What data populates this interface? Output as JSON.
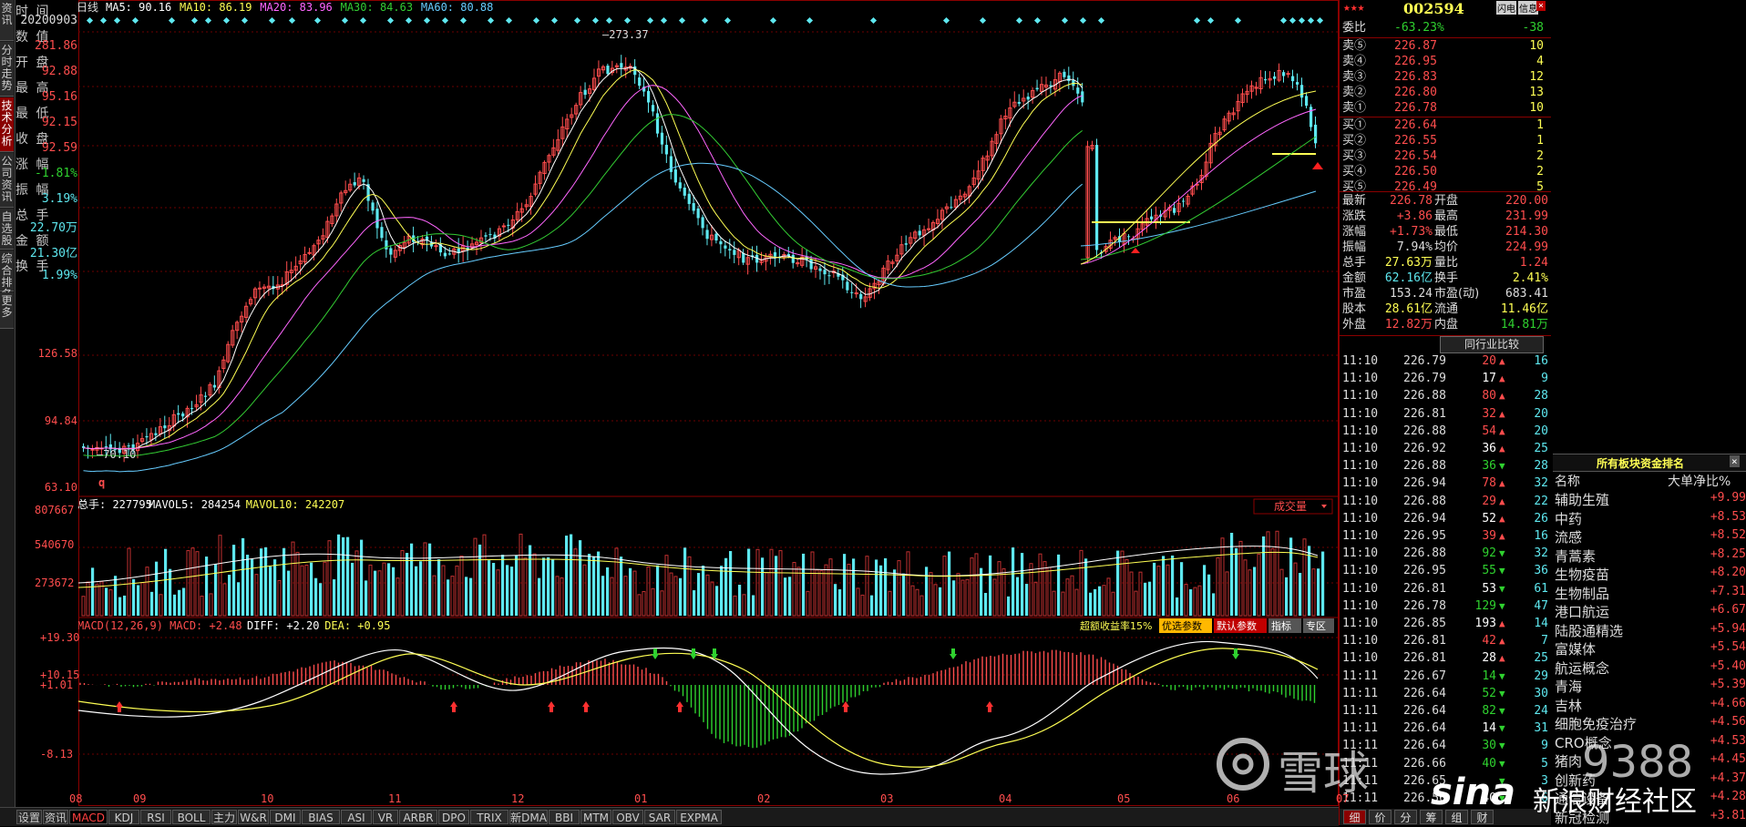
{
  "left_tabs": [
    "资讯",
    "分时走势",
    "技术分析",
    "公司资讯",
    "自选股",
    "综合排名",
    "更多"
  ],
  "left_info": {
    "rows": [
      {
        "label": "时  间",
        "value": "20200903",
        "color": "#dddddd"
      },
      {
        "label": "数  值",
        "value": "281.86",
        "color": "#ff4d4d"
      },
      {
        "label": "开  盘",
        "value": "92.88",
        "color": "#ff4d4d"
      },
      {
        "label": "最  高",
        "value": "95.16",
        "color": "#ff4d4d"
      },
      {
        "label": "最  低",
        "value": "92.15",
        "color": "#ff4d4d"
      },
      {
        "label": "收  盘",
        "value": "92.59",
        "color": "#ff4d4d"
      },
      {
        "label": "涨  幅",
        "value": "-1.81%",
        "color": "#2fd12f"
      },
      {
        "label": "振  幅",
        "value": "3.19%",
        "color": "#5ee8f0"
      },
      {
        "label": "总  手",
        "value": "22.70万",
        "color": "#5ee8f0"
      },
      {
        "label": "金  额",
        "value": "21.30亿",
        "color": "#5ee8f0"
      },
      {
        "label": "换  手",
        "value": "1.99%",
        "color": "#5ee8f0"
      }
    ]
  },
  "main_chart": {
    "period": "日线",
    "ma_legend": [
      {
        "text": "MA5: 90.16",
        "color": "#ffffff"
      },
      {
        "text": "MA10: 86.19",
        "color": "#ffff54"
      },
      {
        "text": "MA20: 83.96",
        "color": "#ff66ff"
      },
      {
        "text": "MA30: 84.63",
        "color": "#33cc33"
      },
      {
        "text": "MA60: 80.88",
        "color": "#66ccff"
      }
    ],
    "price_axis": [
      "126.58",
      "94.84",
      "63.10"
    ],
    "high_label": "273.37",
    "low_label": "70.10",
    "q_label": "q"
  },
  "volume_panel": {
    "legend": [
      {
        "text": "总手: 227795",
        "color": "#ffffff"
      },
      {
        "text": "MAVOL5: 284254",
        "color": "#ffffff"
      },
      {
        "text": "MAVOL10: 242207",
        "color": "#ffff54"
      }
    ],
    "axis": [
      "807667",
      "540670",
      "273672"
    ],
    "selector": "成交量"
  },
  "macd_panel": {
    "legend": [
      {
        "text": "MACD(12,26,9) MACD: +2.48",
        "color": "#ff4d4d"
      },
      {
        "text": "DIFF: +2.20",
        "color": "#ffffff"
      },
      {
        "text": "DEA: +0.95",
        "color": "#ffff54"
      }
    ],
    "axis": [
      "+19.30",
      "+10.15",
      "+1.01",
      "-8.13"
    ],
    "tags": [
      {
        "text": "超额收益率15%",
        "style": "plain"
      },
      {
        "text": "优选参数",
        "style": "yellow"
      },
      {
        "text": "默认参数",
        "style": "red"
      },
      {
        "text": "指标",
        "style": "gray"
      },
      {
        "text": "专区",
        "style": "gray"
      }
    ]
  },
  "months": [
    "08",
    "09",
    "10",
    "11",
    "12",
    "01",
    "02",
    "03",
    "04",
    "05",
    "06",
    "07"
  ],
  "bottom_tabs": [
    "设置",
    "资讯",
    "MACD",
    "KDJ",
    "RSI",
    "BOLL",
    "主力",
    "W&R",
    "DMI",
    "BIAS",
    "ASI",
    "VR",
    "ARBR",
    "DPO",
    "TRIX",
    "新DMA",
    "BBI",
    "MTM",
    "OBV",
    "SAR",
    "EXPMA"
  ],
  "quote": {
    "code": "002594",
    "top_buttons": [
      "闪电",
      "信息"
    ],
    "weibi": {
      "label": "委比",
      "value": "-63.23%",
      "diff": "-38"
    },
    "sells": [
      {
        "label": "卖⑤",
        "price": "226.87",
        "vol": "10"
      },
      {
        "label": "卖④",
        "price": "226.95",
        "vol": "4"
      },
      {
        "label": "卖③",
        "price": "226.83",
        "vol": "12"
      },
      {
        "label": "卖②",
        "price": "226.80",
        "vol": "13"
      },
      {
        "label": "卖①",
        "price": "226.78",
        "vol": "10"
      }
    ],
    "buys": [
      {
        "label": "买①",
        "price": "226.64",
        "vol": "1"
      },
      {
        "label": "买②",
        "price": "226.55",
        "vol": "1"
      },
      {
        "label": "买③",
        "price": "226.54",
        "vol": "2"
      },
      {
        "label": "买④",
        "price": "226.50",
        "vol": "2"
      },
      {
        "label": "买⑤",
        "price": "226.49",
        "vol": "5"
      }
    ],
    "stats": [
      {
        "l1": "最新",
        "v1": "226.78",
        "c1": "#ff4d4d",
        "l2": "开盘",
        "v2": "220.00",
        "c2": "#ff4d4d"
      },
      {
        "l1": "涨跌",
        "v1": "+3.86",
        "c1": "#ff4d4d",
        "l2": "最高",
        "v2": "231.99",
        "c2": "#ff4d4d"
      },
      {
        "l1": "涨幅",
        "v1": "+1.73%",
        "c1": "#ff4d4d",
        "l2": "最低",
        "v2": "214.30",
        "c2": "#ff4d4d"
      },
      {
        "l1": "振幅",
        "v1": "7.94%",
        "c1": "#dddddd",
        "l2": "均价",
        "v2": "224.99",
        "c2": "#ff4d4d"
      },
      {
        "l1": "总手",
        "v1": "27.63万",
        "c1": "#ffff54",
        "l2": "量比",
        "v2": "1.24",
        "c2": "#ff4d4d"
      },
      {
        "l1": "金额",
        "v1": "62.16亿",
        "c1": "#5ee8f0",
        "l2": "换手",
        "v2": "2.41%",
        "c2": "#ffff54"
      },
      {
        "l1": "市盈",
        "v1": "153.24",
        "c1": "#dddddd",
        "l2": "市盈(动)",
        "v2": "683.41",
        "c2": "#dddddd"
      },
      {
        "l1": "股本",
        "v1": "28.61亿",
        "c1": "#ffff54",
        "l2": "流通",
        "v2": "11.46亿",
        "c2": "#ffff54"
      },
      {
        "l1": "外盘",
        "v1": "12.82万",
        "c1": "#ff4d4d",
        "l2": "内盘",
        "v2": "14.81万",
        "c2": "#2fd12f"
      }
    ],
    "compare_button": "同行业比较",
    "ticks": [
      {
        "t": "11:10",
        "p": "226.79",
        "v": "20",
        "dir": "up",
        "n": "16"
      },
      {
        "t": "11:10",
        "p": "226.79",
        "v": "17",
        "dir": "up",
        "n": "9"
      },
      {
        "t": "11:10",
        "p": "226.88",
        "v": "80",
        "dir": "up",
        "n": "28"
      },
      {
        "t": "11:10",
        "p": "226.81",
        "v": "32",
        "dir": "up",
        "n": "20"
      },
      {
        "t": "11:10",
        "p": "226.88",
        "v": "54",
        "dir": "up",
        "n": "20"
      },
      {
        "t": "11:10",
        "p": "226.92",
        "v": "36",
        "dir": "up",
        "n": "25"
      },
      {
        "t": "11:10",
        "p": "226.88",
        "v": "36",
        "dir": "down",
        "n": "28"
      },
      {
        "t": "11:10",
        "p": "226.94",
        "v": "78",
        "dir": "up",
        "n": "32"
      },
      {
        "t": "11:10",
        "p": "226.88",
        "v": "29",
        "dir": "up",
        "n": "22"
      },
      {
        "t": "11:10",
        "p": "226.94",
        "v": "52",
        "dir": "up",
        "n": "26"
      },
      {
        "t": "11:10",
        "p": "226.95",
        "v": "39",
        "dir": "up",
        "n": "16"
      },
      {
        "t": "11:10",
        "p": "226.88",
        "v": "92",
        "dir": "down",
        "n": "32"
      },
      {
        "t": "11:10",
        "p": "226.95",
        "v": "55",
        "dir": "down",
        "n": "36"
      },
      {
        "t": "11:10",
        "p": "226.81",
        "v": "53",
        "dir": "down",
        "n": "61"
      },
      {
        "t": "11:10",
        "p": "226.78",
        "v": "129",
        "dir": "down",
        "n": "47"
      },
      {
        "t": "11:10",
        "p": "226.85",
        "v": "193",
        "dir": "up",
        "n": "14"
      },
      {
        "t": "11:10",
        "p": "226.81",
        "v": "42",
        "dir": "up",
        "n": "7"
      },
      {
        "t": "11:10",
        "p": "226.81",
        "v": "28",
        "dir": "up",
        "n": "25"
      },
      {
        "t": "11:11",
        "p": "226.67",
        "v": "14",
        "dir": "down",
        "n": "29"
      },
      {
        "t": "11:11",
        "p": "226.64",
        "v": "52",
        "dir": "down",
        "n": "30"
      },
      {
        "t": "11:11",
        "p": "226.64",
        "v": "82",
        "dir": "down",
        "n": "24"
      },
      {
        "t": "11:11",
        "p": "226.64",
        "v": "14",
        "dir": "down",
        "n": "31"
      },
      {
        "t": "11:11",
        "p": "226.64",
        "v": "30",
        "dir": "down",
        "n": "9"
      },
      {
        "t": "11:11",
        "p": "226.66",
        "v": "40",
        "dir": "down",
        "n": "5"
      },
      {
        "t": "11:11",
        "p": "226.65",
        "v": "",
        "dir": "down",
        "n": "3"
      },
      {
        "t": "11:11",
        "p": "226.56",
        "v": "40",
        "dir": "down",
        "n": "6"
      }
    ],
    "bottom_tabs": [
      "细",
      "价",
      "分",
      "筹",
      "组",
      "财"
    ]
  },
  "sector_rank": {
    "title": "所有板块资金排名",
    "col_name": "名称",
    "col_value": "大单净比%",
    "rows": [
      {
        "name": "辅助生殖",
        "value": "+9.99"
      },
      {
        "name": "中药",
        "value": "+8.53"
      },
      {
        "name": "流感",
        "value": "+8.52"
      },
      {
        "name": "青蒿素",
        "value": "+8.25"
      },
      {
        "name": "生物疫苗",
        "value": "+8.20"
      },
      {
        "name": "生物制品",
        "value": "+7.31"
      },
      {
        "name": "港口航运",
        "value": "+6.67"
      },
      {
        "name": "陆股通精选",
        "value": "+5.94"
      },
      {
        "name": "富媒体",
        "value": "+5.54"
      },
      {
        "name": "航运概念",
        "value": "+5.40"
      },
      {
        "name": "青海",
        "value": "+5.39"
      },
      {
        "name": "吉林",
        "value": "+4.66"
      },
      {
        "name": "细胞免疫治疗",
        "value": "+4.56"
      },
      {
        "name": "CRO概念",
        "value": "+4.53"
      },
      {
        "name": "猪肉",
        "value": "+4.45"
      },
      {
        "name": "创新药",
        "value": "+4.37"
      },
      {
        "name": "通信设备",
        "value": "+4.28"
      },
      {
        "name": "新冠检测",
        "value": "+3.81"
      }
    ]
  },
  "watermark": {
    "xueqiu": "雪球",
    "id": "9388",
    "sina": "sina",
    "sina_cn": "新浪财经社区"
  }
}
